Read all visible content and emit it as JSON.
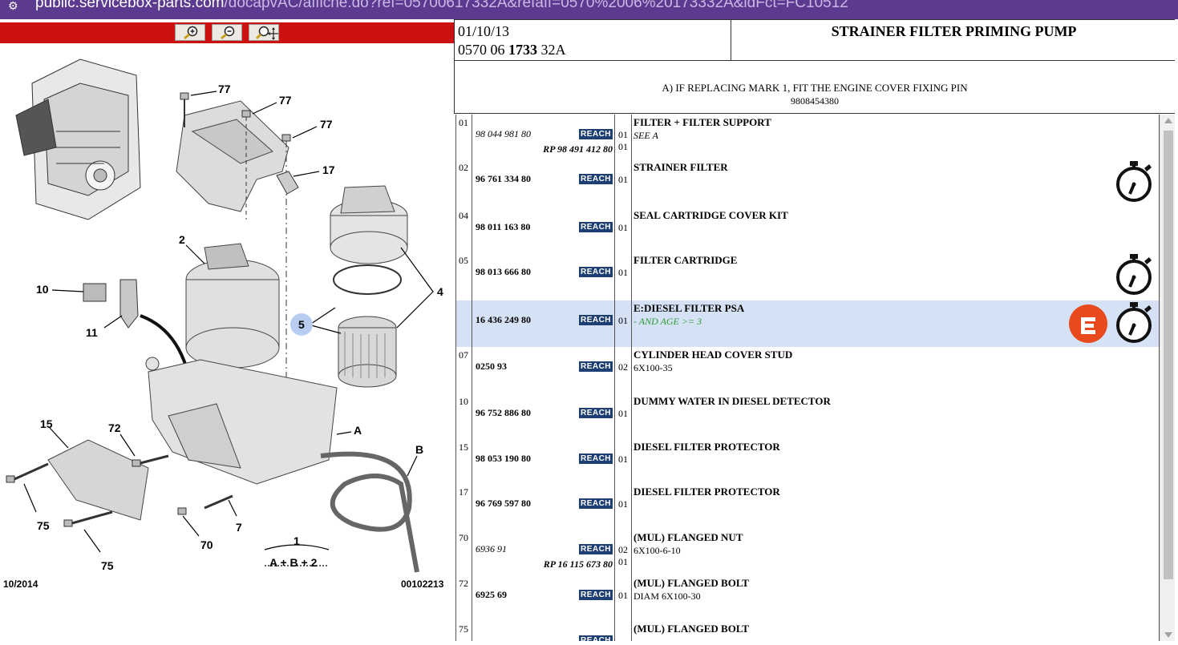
{
  "address_bar": {
    "host": "public.servicebox-parts.com",
    "path": "/docapvAC/affiche.do?ref=05700617332A&refaff=0570%2006%20173332A&idFct=FC10512"
  },
  "toolbar": {
    "zoom_in_icon": "zoom-in-icon",
    "zoom_out_icon": "zoom-out-icon",
    "zoom_pan_icon": "zoom-move-icon",
    "bar_color": "#cc1111"
  },
  "diagram": {
    "labels": {
      "l77a": "77",
      "l77b": "77",
      "l77c": "77",
      "l17": "17",
      "l2": "2",
      "l10": "10",
      "l11": "11",
      "l4": "4",
      "l5": "5",
      "lA": "A",
      "l15": "15",
      "l72": "72",
      "lB": "B",
      "l75a": "75",
      "l75b": "75",
      "l70": "70",
      "l7": "7",
      "l1": "1",
      "formula": "A + B + 2"
    },
    "footer_left": "10/2014",
    "footer_right": "00102213"
  },
  "header": {
    "date": "01/10/13",
    "ref_prefix": "0570 06 ",
    "ref_bold": "1733",
    "ref_suffix": " 32A",
    "title": "STRAINER FILTER PRIMING PUMP"
  },
  "note": {
    "line1": "A) IF REPLACING MARK 1, FIT THE ENGINE COVER FIXING PIN",
    "line2": "9808454380"
  },
  "reach_label": "REACH",
  "parts": [
    {
      "mark": "01",
      "part": "98 044 981 80",
      "rp": "RP 98 491 412 80",
      "qty": "01",
      "qty2": "01",
      "name": "FILTER + FILTER SUPPORT",
      "sub": "SEE A"
    },
    {
      "mark": "02",
      "part": "96 761 334 80",
      "qty": "01",
      "name": "STRAINER FILTER"
    },
    {
      "mark": "04",
      "part": "98 011 163 80",
      "qty": "01",
      "name": "SEAL CARTRIDGE COVER KIT"
    },
    {
      "mark": "05",
      "part": "98 013 666 80",
      "qty": "01",
      "name": "FILTER CARTRIDGE"
    },
    {
      "mark": "",
      "part": "16 436 249 80",
      "qty": "01",
      "name": "E:DIESEL FILTER PSA",
      "sub": "- AND AGE >= 3"
    },
    {
      "mark": "07",
      "part": "0250 93",
      "qty": "02",
      "name": "CYLINDER HEAD COVER STUD",
      "sub": "6X100-35"
    },
    {
      "mark": "10",
      "part": "96 752 886 80",
      "qty": "01",
      "name": "DUMMY WATER IN DIESEL DETECTOR"
    },
    {
      "mark": "15",
      "part": "98 053 190 80",
      "qty": "01",
      "name": "DIESEL FILTER PROTECTOR"
    },
    {
      "mark": "17",
      "part": "96 769 597 80",
      "qty": "01",
      "name": "DIESEL FILTER PROTECTOR"
    },
    {
      "mark": "70",
      "part": "6936 91",
      "rp": "RP 16 115 673 80",
      "qty": "02",
      "qty2": "01",
      "name": "(MUL) FLANGED NUT",
      "sub": "6X100-6-10"
    },
    {
      "mark": "72",
      "part": "6925 69",
      "qty": "01",
      "name": "(MUL) FLANGED BOLT",
      "sub": "DIAM 6X100-30"
    },
    {
      "mark": "75",
      "part": "",
      "qty": "",
      "name": "(MUL) FLANGED BOLT"
    }
  ],
  "icons": {
    "labour_time": "stopwatch-icon",
    "e_product": "e-logo-icon",
    "e_color": "#e8491d",
    "highlight_color": "#d5e2f6"
  }
}
